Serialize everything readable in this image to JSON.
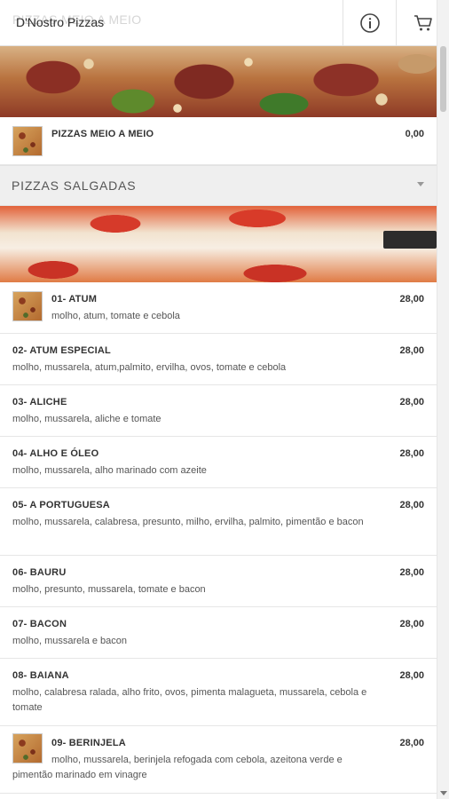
{
  "header": {
    "faded_title": "PIZZAS MEIO A MEIO",
    "title": "D'Nostro Pizzas",
    "info_icon": "info-icon",
    "cart_icon": "cart-icon"
  },
  "half_half": {
    "name": "PIZZAS MEIO A MEIO",
    "price": "0,00"
  },
  "section": {
    "title": "PIZZAS SALGADAS",
    "chevron_icon": "chevron-down-icon"
  },
  "items": [
    {
      "name": "01- ATUM",
      "desc": "molho, atum, tomate e cebola",
      "price": "28,00",
      "has_thumb": true
    },
    {
      "name": "02- ATUM ESPECIAL",
      "desc": "molho, mussarela, atum,palmito, ervilha, ovos, tomate e cebola",
      "price": "28,00"
    },
    {
      "name": "03- ALICHE",
      "desc": "molho, mussarela, aliche e tomate",
      "price": "28,00"
    },
    {
      "name": "04- ALHO E ÓLEO",
      "desc": "molho, mussarela, alho marinado com azeite",
      "price": "28,00"
    },
    {
      "name": "05- A PORTUGUESA",
      "desc": "molho, mussarela, calabresa, presunto, milho, ervilha, palmito, pimentão e bacon",
      "price": "28,00"
    },
    {
      "name": "06- BAURU",
      "desc": "molho, presunto, mussarela, tomate e bacon",
      "price": "28,00"
    },
    {
      "name": "07- BACON",
      "desc": "molho, mussarela e bacon",
      "price": "28,00"
    },
    {
      "name": "08- BAIANA",
      "desc": "molho, calabresa ralada, alho frito, ovos, pimenta malagueta, mussarela, cebola e tomate",
      "price": "28,00"
    },
    {
      "name": "09- BERINJELA",
      "desc": "molho, mussarela, berinjela refogada com cebola, azeitona verde e pimentão marinado em vinagre",
      "price": "28,00",
      "has_thumb": true
    }
  ]
}
